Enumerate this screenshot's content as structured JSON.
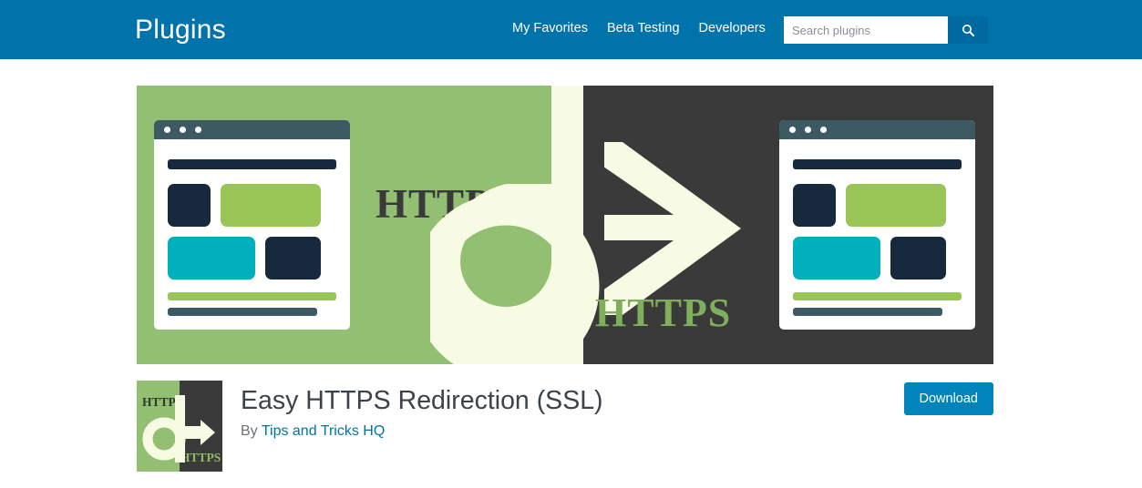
{
  "header": {
    "site_title": "Plugins",
    "background_color": "#0073aa",
    "nav_items": [
      {
        "label": "My Favorites"
      },
      {
        "label": "Beta Testing"
      },
      {
        "label": "Developers"
      }
    ],
    "search": {
      "placeholder": "Search plugins",
      "value": "",
      "button_icon": "search-icon",
      "button_color": "#0069a0"
    }
  },
  "banner": {
    "left_background": "#92bf72",
    "right_background": "#3a3a3a",
    "cream_color": "#f7fbe4",
    "http_label": "HTTP",
    "https_label": "HTTPS",
    "http_color": "#3a3a3a",
    "https_color": "#7fae5c",
    "mockup_colors": {
      "titlebar": "#3d5a63",
      "navy": "#17293d",
      "green": "#99c456",
      "teal": "#00b0bd",
      "slate": "#3d5a63"
    }
  },
  "plugin": {
    "icon": {
      "http_label": "HTTP",
      "https_label": "HTTPS"
    },
    "title": "Easy HTTPS Redirection (SSL)",
    "by_label": "By",
    "author": "Tips and Tricks HQ",
    "author_link_color": "#0073aa",
    "download_label": "Download",
    "download_color": "#0085ba"
  }
}
